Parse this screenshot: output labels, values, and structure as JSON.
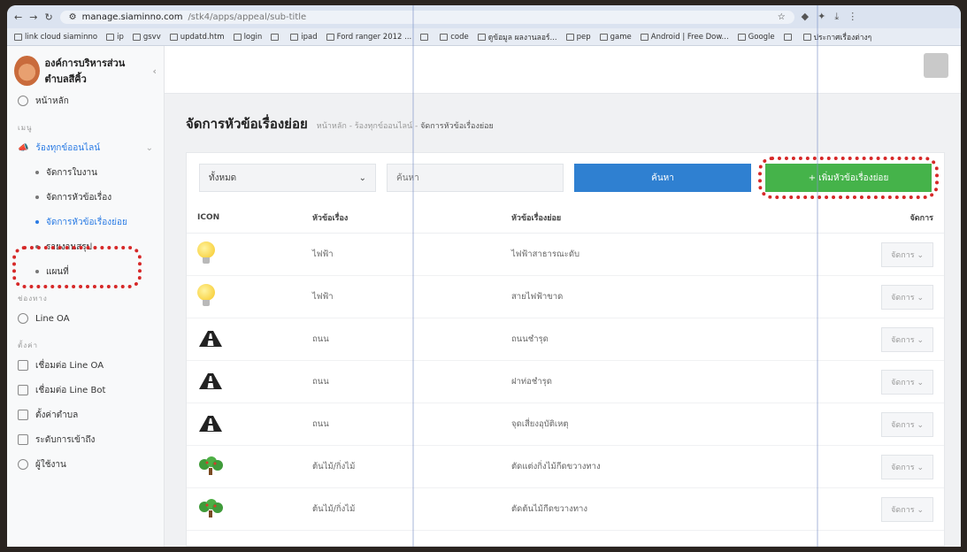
{
  "browser": {
    "url_host": "manage.siaminno.com",
    "url_path": "/stk4/apps/appeal/sub-title",
    "bookmarks": [
      "link cloud siaminno",
      "ip",
      "gsvv",
      "updatd.htm",
      "login",
      "",
      "ipad",
      "Ford ranger 2012 ...",
      "",
      "code",
      "ดูข้อมูล ผลงานลอร์...",
      "pep",
      "game",
      "Android | Free Dow...",
      "Google",
      "",
      "ประกาศเรื่องต่างๆ"
    ]
  },
  "sidebar": {
    "brand": "องค์การบริหารส่วนตำบลสีคิ้ว",
    "home": "หน้าหลัก",
    "section_main": "เมนู",
    "complaints": "ร้องทุกข์ออนไลน์",
    "sub_items": [
      "จัดการใบงาน",
      "จัดการหัวข้อเรื่อง",
      "จัดการหัวข้อเรื่องย่อย",
      "รายงานสรุป",
      "แผนที่"
    ],
    "section_line": "ช่องทาง",
    "line_oa": "Line OA",
    "section_settings": "ตั้งค่า",
    "settings_items": [
      "เชื่อมต่อ Line OA",
      "เชื่อมต่อ Line Bot",
      "ตั้งค่าตำบล",
      "ระดับการเข้าถึง",
      "ผู้ใช้งาน"
    ]
  },
  "page": {
    "title": "จัดการหัวข้อเรื่องย่อย",
    "breadcrumb_home": "หน้าหลัก",
    "breadcrumb_mid": "ร้องทุกข์ออนไลน์",
    "breadcrumb_current": "จัดการหัวข้อเรื่องย่อย"
  },
  "filters": {
    "select_value": "ทั้งหมด",
    "search_placeholder": "ค้นหา",
    "search_button": "ค้นหา",
    "add_button": "+ เพิ่มหัวข้อเรื่องย่อย"
  },
  "table": {
    "headers": [
      "ICON",
      "หัวข้อเรื่อง",
      "หัวข้อเรื่องย่อย",
      "จัดการ"
    ],
    "rows": [
      {
        "icon": "light-bulb-icon",
        "topic": "ไฟฟ้า",
        "subtopic": "ไฟฟ้าสาธารณะดับ",
        "action": "จัดการ ⌄"
      },
      {
        "icon": "light-bulb-icon",
        "topic": "ไฟฟ้า",
        "subtopic": "สายไฟฟ้าขาด",
        "action": "จัดการ ⌄"
      },
      {
        "icon": "road-icon",
        "topic": "ถนน",
        "subtopic": "ถนนชำรุด",
        "action": "จัดการ ⌄"
      },
      {
        "icon": "road-icon",
        "topic": "ถนน",
        "subtopic": "ฝาท่อชำรุด",
        "action": "จัดการ ⌄"
      },
      {
        "icon": "road-icon",
        "topic": "ถนน",
        "subtopic": "จุดเสี่ยงอุบัติเหตุ",
        "action": "จัดการ ⌄"
      },
      {
        "icon": "tree-icon",
        "topic": "ต้นไม้/กิ่งไม้",
        "subtopic": "ตัดแต่งกิ่งไม้กีดขวางทาง",
        "action": "จัดการ ⌄"
      },
      {
        "icon": "tree-icon",
        "topic": "ต้นไม้/กิ่งไม้",
        "subtopic": "ตัดต้นไม้กีดขวางทาง",
        "action": "จัดการ ⌄"
      }
    ]
  },
  "colors": {
    "primary": "#2f80d1",
    "success": "#45b34a",
    "highlight": "#d62828"
  }
}
